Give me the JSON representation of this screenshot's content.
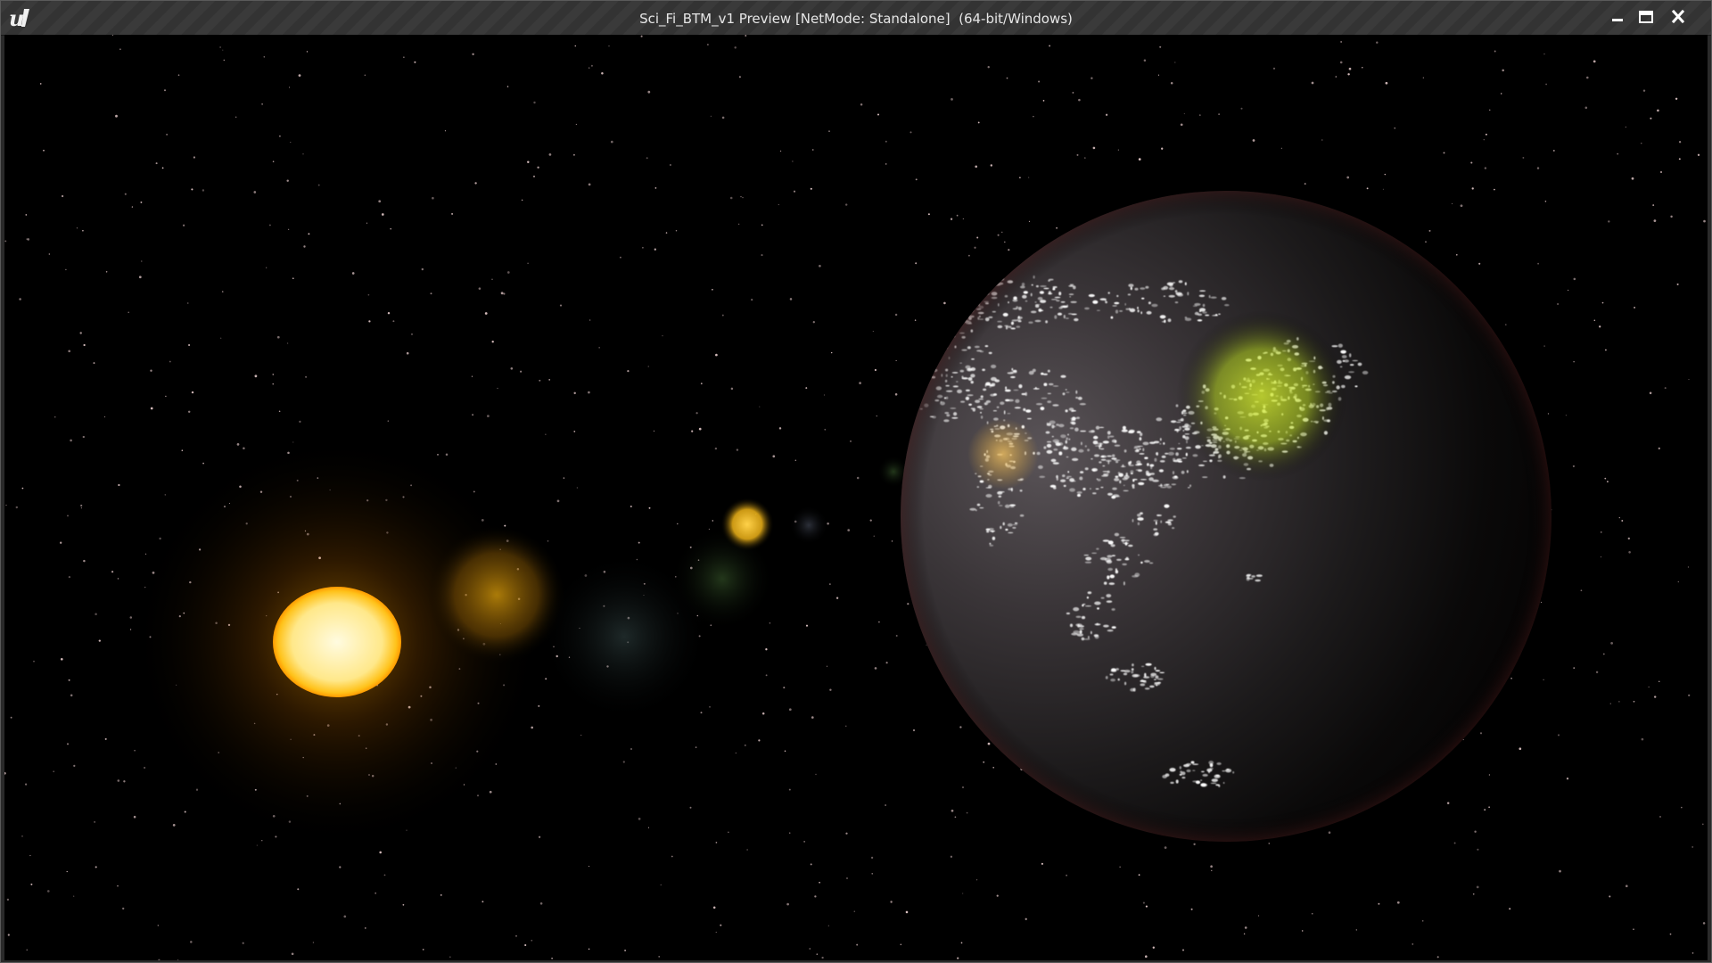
{
  "window": {
    "title": "Sci_Fi_BTM_v1 Preview [NetMode: Standalone]  (64-bit/Windows)",
    "logo_icon": "unreal-engine-logo-icon",
    "buttons": {
      "minimize_icon": "minimize-icon",
      "maximize_icon": "maximize-icon",
      "close_icon": "close-icon"
    }
  },
  "scene": {
    "background_color": "#000000",
    "star_color": "#f2d6d6",
    "sun_color": "#ffe27a",
    "earth_color": "#2a2628",
    "city_lights_color": "#ffffff",
    "flare_colors": [
      "#c8900a",
      "#2b3a3a",
      "#2f4a24",
      "#f0b418",
      "#e0a83a",
      "#b8d81e"
    ]
  }
}
